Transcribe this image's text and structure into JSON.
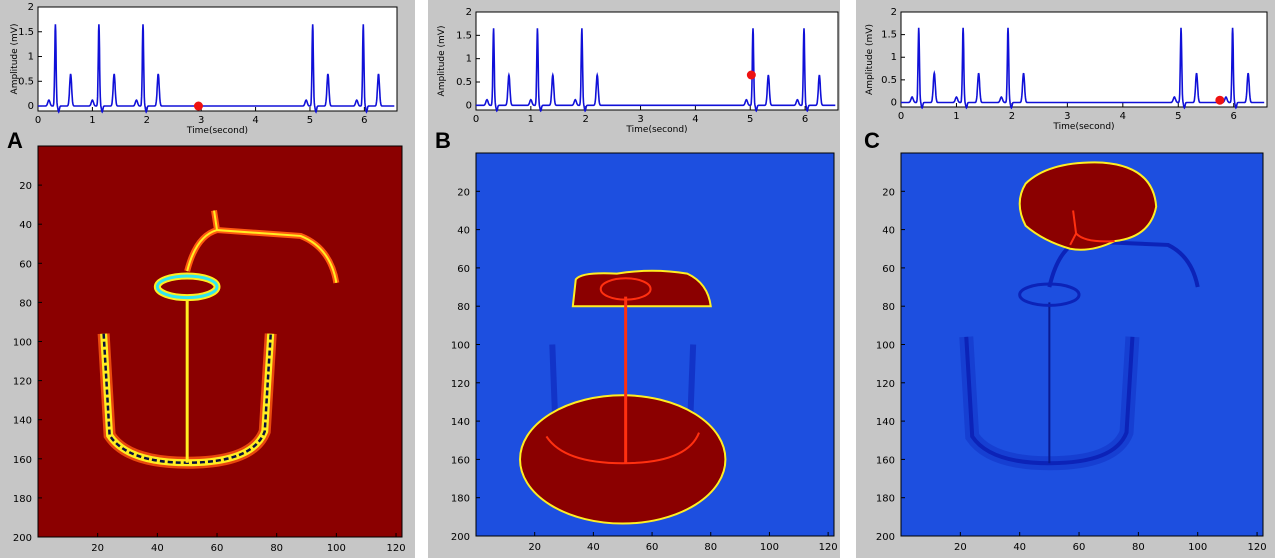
{
  "colors": {
    "bg_gray": "#c6c6c6",
    "signal": "#1010d8",
    "marker": "#ee1111",
    "dark_red": "#8b0000",
    "blue_field": "#1d4fe0",
    "deep_blue": "#0c23b8",
    "yellow": "#ffee22",
    "cyan": "#33e6ee",
    "orange": "#ff5a10"
  },
  "chart_data": [
    {
      "type": "line+heatmap",
      "panel_letter": "A",
      "trace": {
        "xlabel": "Time(second)",
        "ylabel": "Amplitude (mV)",
        "xlim": [
          0,
          6.6
        ],
        "ylim": [
          -0.1,
          2
        ],
        "xticks": [
          0,
          1,
          2,
          3,
          4,
          5,
          6
        ],
        "yticks": [
          0,
          0.5,
          1,
          1.5,
          2
        ],
        "marker": {
          "x": 2.95,
          "y": 0
        }
      },
      "heatmap": {
        "xlim": [
          0,
          122
        ],
        "ylim": [
          0,
          200
        ],
        "xticks": [
          20,
          40,
          60,
          80,
          100,
          120
        ],
        "yticks": [
          20,
          40,
          60,
          80,
          100,
          120,
          140,
          160,
          180,
          200
        ],
        "background": "dark red"
      }
    },
    {
      "type": "line+heatmap",
      "panel_letter": "B",
      "trace": {
        "xlabel": "Time(second)",
        "ylabel": "Amplitude (mV)",
        "xlim": [
          0,
          6.6
        ],
        "ylim": [
          -0.1,
          2
        ],
        "xticks": [
          0,
          1,
          2,
          3,
          4,
          5,
          6
        ],
        "yticks": [
          0,
          0.5,
          1,
          1.5,
          2
        ],
        "marker": {
          "x": 5.02,
          "y": 0.65
        }
      },
      "heatmap": {
        "xlim": [
          0,
          122
        ],
        "ylim": [
          0,
          200
        ],
        "xticks": [
          20,
          40,
          60,
          80,
          100,
          120
        ],
        "yticks": [
          20,
          40,
          60,
          80,
          100,
          120,
          140,
          160,
          180,
          200
        ],
        "background": "blue"
      }
    },
    {
      "type": "line+heatmap",
      "panel_letter": "C",
      "trace": {
        "xlabel": "Time(second)",
        "ylabel": "Amplitude (mV)",
        "xlim": [
          0,
          6.6
        ],
        "ylim": [
          -0.1,
          2
        ],
        "xticks": [
          0,
          1,
          2,
          3,
          4,
          5,
          6
        ],
        "yticks": [
          0,
          0.5,
          1,
          1.5,
          2
        ],
        "marker": {
          "x": 5.75,
          "y": 0.05
        }
      },
      "heatmap": {
        "xlim": [
          0,
          122
        ],
        "ylim": [
          0,
          200
        ],
        "xticks": [
          20,
          40,
          60,
          80,
          100,
          120
        ],
        "yticks": [
          20,
          40,
          60,
          80,
          100,
          120,
          140,
          160,
          180,
          200
        ],
        "background": "blue"
      }
    }
  ]
}
